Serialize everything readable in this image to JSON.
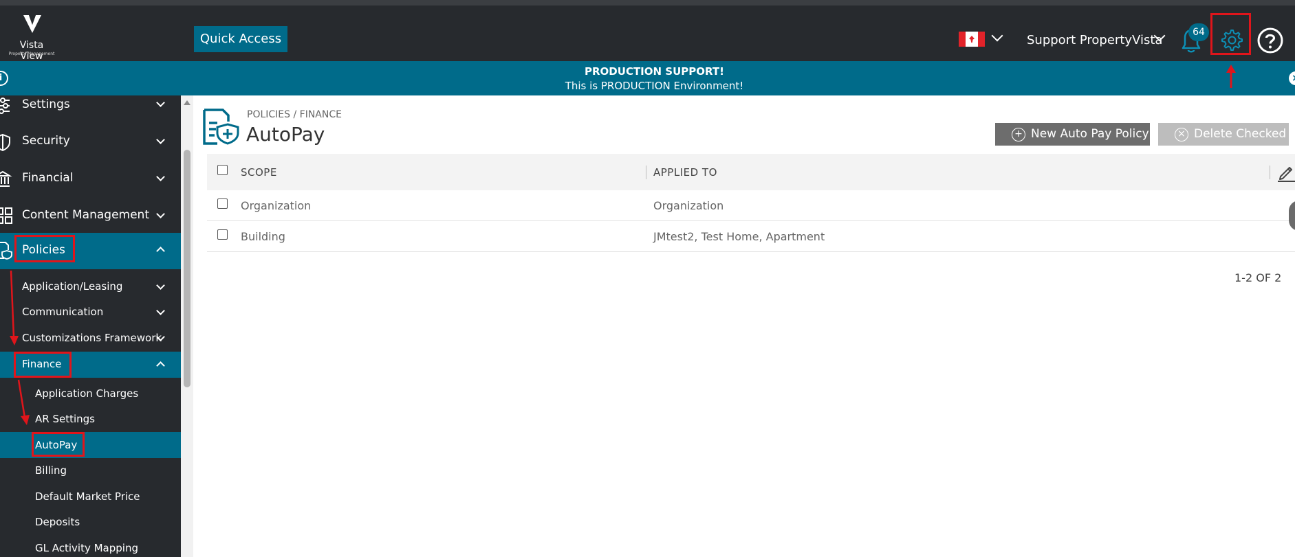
{
  "header": {
    "logo_name": "Vista View",
    "logo_sub": "Property Management",
    "quick_access": "Quick Access",
    "user": "Support PropertyVista",
    "notification_count": "64",
    "colors": {
      "header_bg": "#272a2e",
      "accent": "#006b8a",
      "annotation": "#e0151b"
    }
  },
  "banner": {
    "title": "PRODUCTION SUPPORT!",
    "text": "This is PRODUCTION Environment!",
    "info_icon": "i",
    "close_icon": "×"
  },
  "sidebar": {
    "items": [
      {
        "label": "Settings",
        "icon": "sliders-icon",
        "state": "collapsed"
      },
      {
        "label": "Security",
        "icon": "shield-icon",
        "state": "collapsed"
      },
      {
        "label": "Financial",
        "icon": "bank-icon",
        "state": "collapsed"
      },
      {
        "label": "Content Management",
        "icon": "grid-icon",
        "state": "collapsed"
      },
      {
        "label": "Policies",
        "icon": "policy-doc-icon",
        "state": "expanded"
      },
      {
        "label": "Application/Leasing",
        "state": "collapsed"
      },
      {
        "label": "Communication",
        "state": "collapsed"
      },
      {
        "label": "Customizations Framework",
        "state": "collapsed"
      },
      {
        "label": "Finance",
        "state": "expanded"
      },
      {
        "label": "Application Charges"
      },
      {
        "label": "AR Settings"
      },
      {
        "label": "AutoPay",
        "state": "selected"
      },
      {
        "label": "Billing"
      },
      {
        "label": "Default Market Price"
      },
      {
        "label": "Deposits"
      },
      {
        "label": "GL Activity Mapping"
      }
    ]
  },
  "page": {
    "breadcrumb": "POLICIES / FINANCE",
    "title": "AutoPay",
    "new_button": "New Auto Pay Policy",
    "delete_button": "Delete Checked"
  },
  "table": {
    "columns": [
      "SCOPE",
      "APPLIED TO"
    ],
    "rows": [
      {
        "scope": "Organization",
        "applied_to": "Organization"
      },
      {
        "scope": "Building",
        "applied_to": "JMtest2, Test Home, Apartment"
      }
    ],
    "pager": "1-2 OF 2"
  }
}
